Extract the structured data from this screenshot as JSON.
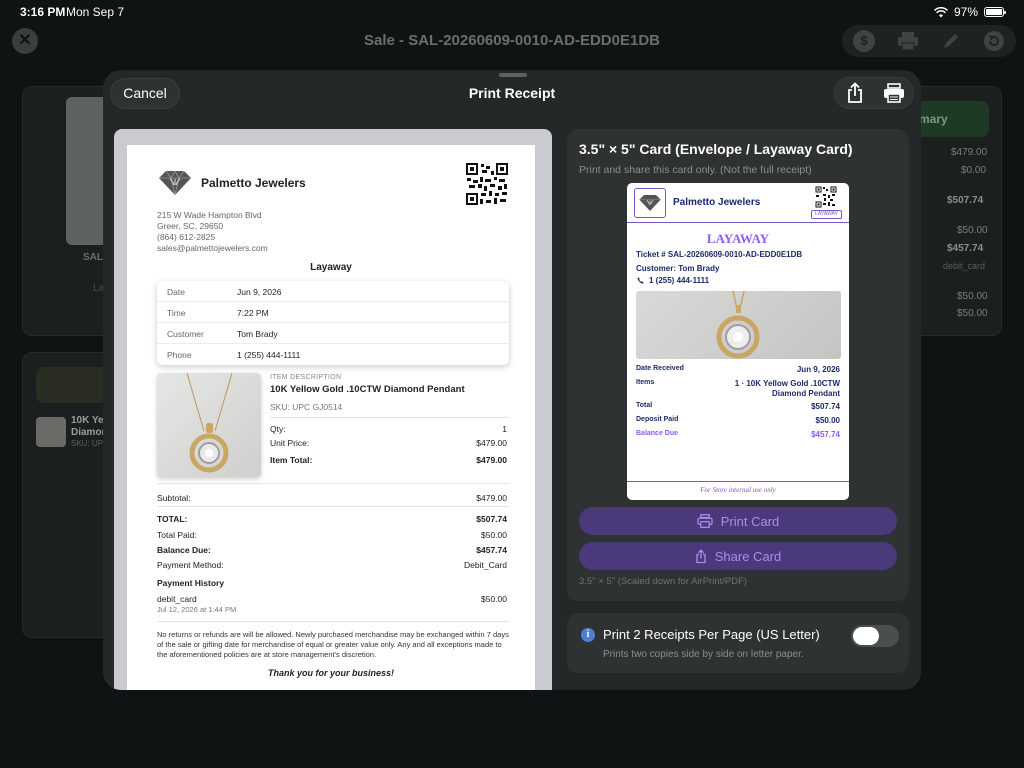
{
  "status_bar": {
    "time": "3:16 PM",
    "date": "Mon Sep 7",
    "battery": "97%",
    "battery_level": 0.97
  },
  "background": {
    "title": "Sale - SAL-20260609-0010-AD-EDD0E1DB",
    "summary_label": "mary",
    "left_label": "SAL",
    "left_sub": "La",
    "line_item_name_1": "10K Yel",
    "line_item_name_2": "Diamon",
    "line_item_sku": "SKU: UP",
    "summary_values": [
      "$479.00",
      "$0.00",
      "$507.74",
      "$50.00",
      "$457.74",
      "debit_card",
      "$50.00",
      "$50.00"
    ]
  },
  "sheet": {
    "cancel_label": "Cancel",
    "title": "Print Receipt"
  },
  "receipt": {
    "store_name": "Palmetto Jewelers",
    "address_lines": [
      "215 W Wade Hampton Blvd",
      "Greer, SC, 29650",
      "(864) 612-2825",
      "sales@palmettojewelers.com"
    ],
    "heading": "Layaway",
    "info": [
      {
        "label": "Date",
        "value": "Jun 9, 2026"
      },
      {
        "label": "Time",
        "value": "7:22 PM"
      },
      {
        "label": "Customer",
        "value": "Tom Brady"
      },
      {
        "label": "Phone",
        "value": "1 (255) 444-1111"
      }
    ],
    "item": {
      "desc_label": "ITEM DESCRIPTION",
      "name": "10K Yellow Gold .10CTW Diamond Pendant",
      "sku": "SKU:  UPC GJ0514",
      "qty_label": "Qty:",
      "qty": "1",
      "unit_price_label": "Unit Price:",
      "unit_price": "$479.00",
      "item_total_label": "Item Total:",
      "item_total": "$479.00"
    },
    "subtotal_label": "Subtotal:",
    "subtotal": "$479.00",
    "total_label": "TOTAL:",
    "total": "$507.74",
    "total_paid_label": "Total Paid:",
    "total_paid": "$50.00",
    "balance_due_label": "Balance Due:",
    "balance_due": "$457.74",
    "payment_method_label": "Payment Method:",
    "payment_method": "Debit_Card",
    "payment_history_label": "Payment History",
    "payment_history": {
      "method": "debit_card",
      "date": "Jul 12, 2026 at 1:44 PM",
      "amount": "$50.00"
    },
    "policy": "No returns or refunds are will be allowed. Newly purchased merchandise may be exchanged within 7 days of the sale or gifting date for merchandise of equal or greater value only. Any and all exceptions made to the aforementioned policies are at store management's discretion.",
    "thanks": "Thank you for your business!"
  },
  "card_panel": {
    "title": "3.5\" × 5\" Card (Envelope / Layaway Card)",
    "subtitle": "Print and share this card only. (Not the full receipt)",
    "print_label": "Print Card",
    "share_label": "Share Card",
    "note": "3.5\" × 5\" (Scaled down for AirPrint/PDF)",
    "accent_color": "#8b5cf6"
  },
  "card": {
    "store_name": "Palmetto Jewelers",
    "badge": "LAYAWAY",
    "heading": "LAYAWAY",
    "ticket": "Ticket # SAL-20260609-0010-AD-EDD0E1DB",
    "customer": "Customer: Tom Brady",
    "phone": "1 (255) 444-1111",
    "date_received_label": "Date Received",
    "date_received": "Jun 9, 2026",
    "items_label": "Items",
    "items_line1": "1 · 10K Yellow Gold .10CTW",
    "items_line2": "Diamond Pendant",
    "total_label": "Total",
    "total": "$507.74",
    "deposit_label": "Deposit Paid",
    "deposit": "$50.00",
    "balance_label": "Balance Due",
    "balance": "$457.74",
    "footer": "For Store internal use only"
  },
  "toggle": {
    "title": "Print 2 Receipts Per Page (US Letter)",
    "subtitle": "Prints two copies side by side on letter paper.",
    "enabled": false
  },
  "icons": [
    "close-icon",
    "dollar-icon",
    "printer-icon",
    "pencil-icon",
    "refresh-icon",
    "share-icon",
    "printer-icon",
    "diamond-logo-icon",
    "qr-code-icon",
    "phone-icon",
    "info-icon"
  ]
}
